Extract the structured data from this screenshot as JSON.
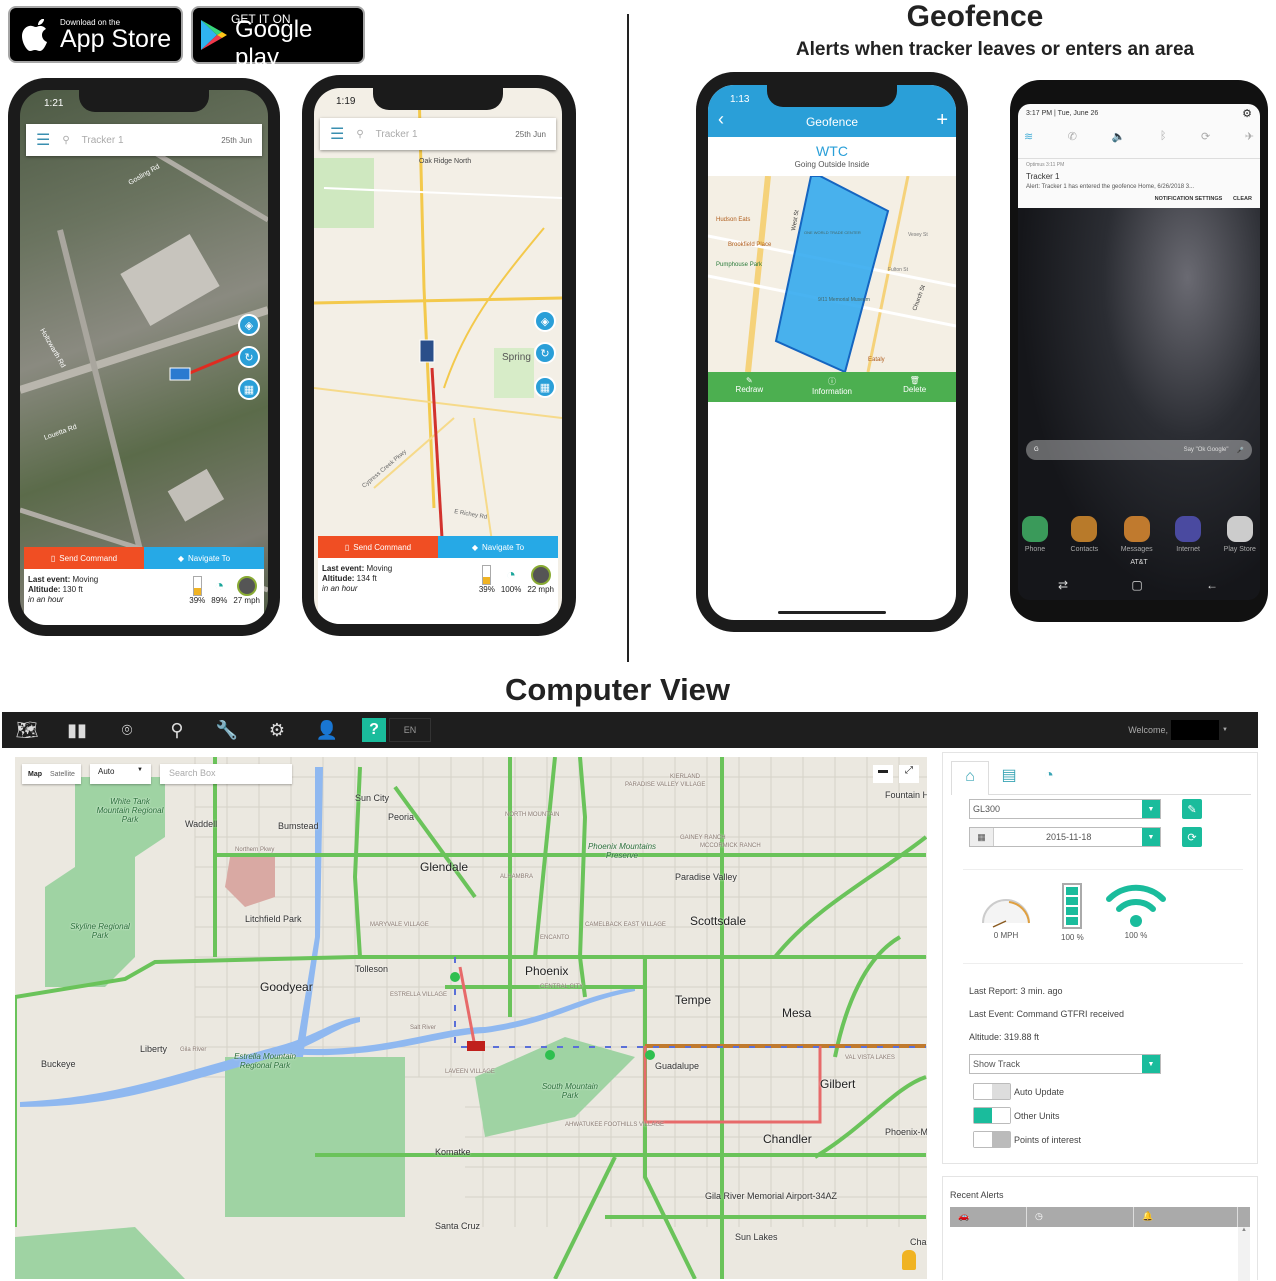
{
  "badges": {
    "appstore_small": "Download on the",
    "appstore_big": "App Store",
    "google_small": "GET IT ON",
    "google_big": "Google play"
  },
  "geofence_header": {
    "title": "Geofence",
    "subtitle": "Alerts when tracker leaves or enters an area"
  },
  "phone1": {
    "time": "1:21",
    "search_placeholder": "Tracker 1",
    "date": "25th Jun",
    "send_command": "Send Command",
    "navigate_to": "Navigate To",
    "last_event_label": "Last event:",
    "last_event": "Moving",
    "altitude_label": "Altitude:",
    "altitude": "130 ft",
    "when": "in an hour",
    "battery": "39%",
    "signal": "89%",
    "speed": "27 mph",
    "roads": [
      "Holtzwarth Rd",
      "Louetta Rd",
      "Gosling Rd"
    ]
  },
  "phone2": {
    "time": "1:19",
    "search_placeholder": "Tracker 1",
    "date": "25th Jun",
    "send_command": "Send Command",
    "navigate_to": "Navigate To",
    "last_event_label": "Last event:",
    "last_event": "Moving",
    "altitude_label": "Altitude:",
    "altitude": "134 ft",
    "when": "in an hour",
    "battery": "39%",
    "signal": "100%",
    "speed": "22 mph",
    "places": [
      "Oak Ridge North",
      "Spring",
      "Cypress Creek Pkwy",
      "E Richey Rd"
    ]
  },
  "phone3": {
    "time": "1:13",
    "title": "Geofence",
    "fence_name": "WTC",
    "fence_mode": "Going Outside Inside",
    "places": [
      "Hudson Eats",
      "Brookfield Place",
      "Pumphouse Park",
      "West St",
      "ONE WORLD TRADE CENTER",
      "9/11 Memorial Museum",
      "Church St",
      "Fulton St",
      "Vesey St",
      "Eataly"
    ],
    "actions": [
      "Redraw",
      "Information",
      "Delete"
    ],
    "accent": "#2a9fd8",
    "action_bar": "#4caf50"
  },
  "samsung": {
    "time": "3:17 PM",
    "date": "Tue, June 26",
    "app": "Optimus",
    "app_time": "3:11 PM",
    "notif_title": "Tracker 1",
    "notif_body": "Alert: Tracker 1 has entered the geofence Home, 6/26/2018 3...",
    "notif_settings": "NOTIFICATION SETTINGS",
    "clear": "CLEAR",
    "search_hint": "Say \"Ok Google\"",
    "apps": [
      "Phone",
      "Contacts",
      "Messages",
      "Internet",
      "Play Store"
    ],
    "carrier": "AT&T"
  },
  "computer_view": {
    "title": "Computer View"
  },
  "toolbar": {
    "icons": [
      "map-icon",
      "reports-icon",
      "geofence-icon",
      "location-icon",
      "wrench-icon",
      "settings-icon",
      "user-settings-icon",
      "help-icon"
    ],
    "help": "?",
    "language": "EN",
    "welcome": "Welcome,",
    "accent": "#1abc9c"
  },
  "map": {
    "type_map": "Map",
    "type_satellite": "Satellite",
    "mode": "Auto",
    "search_placeholder": "Search Box",
    "labels": [
      "White Tank Mountain Regional Park",
      "Waddell",
      "Bumstead",
      "Sun City",
      "Peoria",
      "Glendale",
      "Litchfield Park",
      "Skyline Regional Park",
      "Tolleson",
      "Goodyear",
      "Liberty",
      "Buckeye",
      "Estrella Mountain Regional Park",
      "Komatke",
      "Santa Cruz",
      "Phoenix",
      "Tempe",
      "Scottsdale",
      "Mesa",
      "Gilbert",
      "Chandler",
      "Paradise Valley",
      "Phoenix Mountains Preserve",
      "South Mountain Park",
      "Guadalupe",
      "Fountain Hills",
      "Gila River Memorial Airport-34AZ",
      "Sun Lakes",
      "MARYVALE VILLAGE",
      "ESTRELLA VILLAGE",
      "LAVEEN VILLAGE",
      "ALHAMBRA",
      "ENCANTO",
      "CENTRAL CITY",
      "NORTH MOUNTAIN",
      "KIERLAND",
      "PARADISE VALLEY VILLAGE",
      "GAINEY RANCH",
      "MCCORMICK RANCH",
      "CAMELBACK EAST VILLAGE",
      "AHWATUKEE FOOTHILLS VILLAGE",
      "VAL VISTA LAKES",
      "Phoenix-Mesa Gateway A",
      "Chandler Heigh",
      "Northern Pkwy",
      "Gila River",
      "Salt River"
    ]
  },
  "panel": {
    "device": "GL300",
    "date": "2015-11-18",
    "speed": "0 MPH",
    "battery": "100 %",
    "signal": "100 %",
    "last_report": "Last Report: 3 min. ago",
    "last_event": "Last Event: Command GTFRI received",
    "altitude": "Altitude: 319.88 ft",
    "track_option": "Show Track",
    "toggles": [
      {
        "label": "Auto Update",
        "on": false
      },
      {
        "label": "Other Units",
        "on": true
      },
      {
        "label": "Points of interest",
        "on": false
      }
    ]
  },
  "alerts": {
    "title": "Recent Alerts",
    "columns": [
      "car-icon",
      "clock-icon",
      "bell-icon"
    ]
  }
}
